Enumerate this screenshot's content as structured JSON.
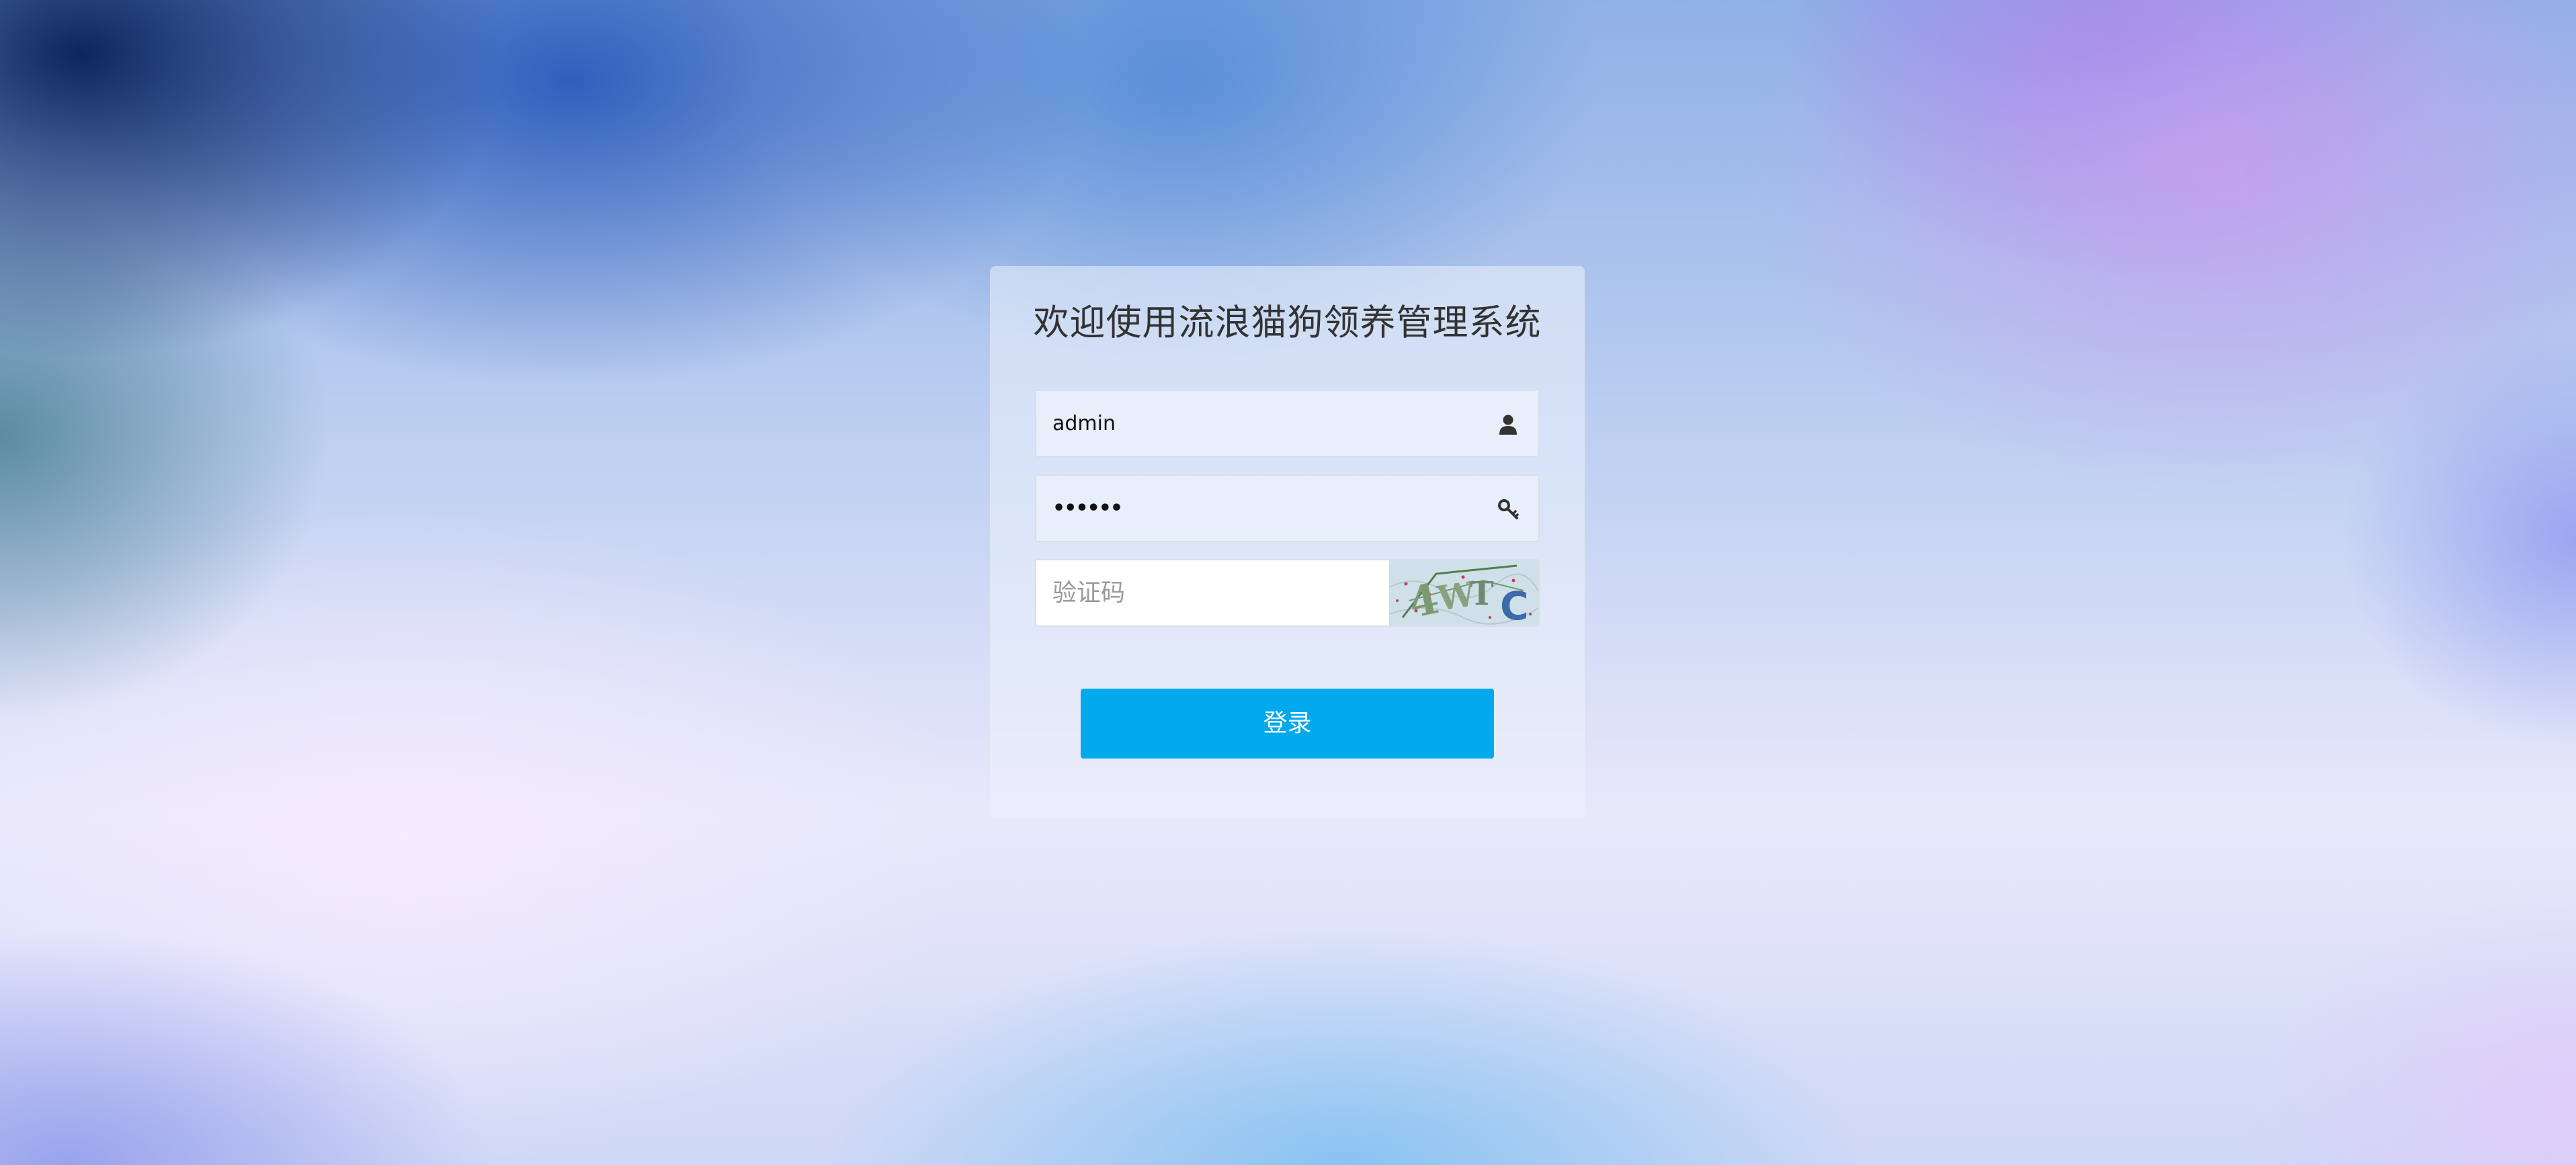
{
  "login": {
    "title": "欢迎使用流浪猫狗领养管理系统",
    "username": {
      "value": "admin",
      "icon": "user-icon"
    },
    "password": {
      "value": "••••••",
      "icon": "key-icon"
    },
    "captcha": {
      "placeholder": "验证码",
      "image_text": "4WTC"
    },
    "submit_label": "登录"
  },
  "colors": {
    "button": "#03a9ed",
    "button_text": "#ffffff",
    "title_text": "#333333"
  }
}
